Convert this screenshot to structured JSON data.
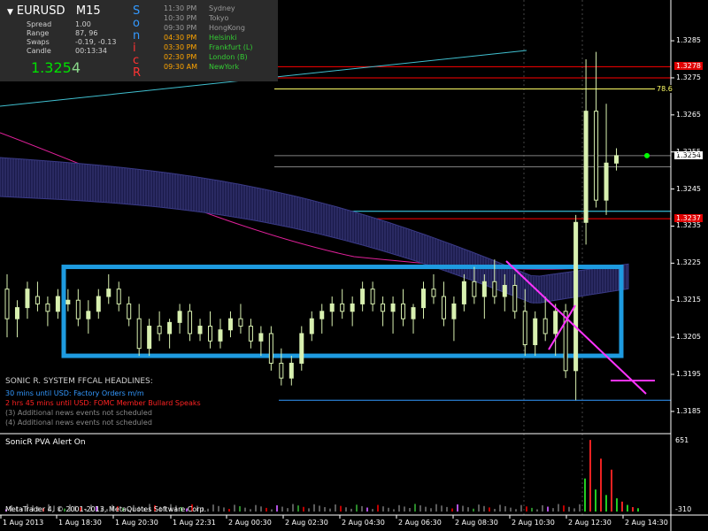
{
  "header": {
    "symbol": "EURUSD",
    "timeframe": "M15",
    "stats": [
      {
        "label": "Spread",
        "value": "1.00"
      },
      {
        "label": "Range",
        "value": "87, 96"
      },
      {
        "label": "Swaps",
        "value": "-0.19, -0.13"
      },
      {
        "label": "Candle",
        "value": "00:13:34"
      }
    ],
    "price_main": "1.325",
    "price_last": "4",
    "sonic_letters": [
      {
        "ch": "S",
        "color": "#3399ff"
      },
      {
        "ch": "o",
        "color": "#3399ff"
      },
      {
        "ch": "n",
        "color": "#3399ff"
      },
      {
        "ch": "i",
        "color": "#ff3333"
      },
      {
        "ch": "c",
        "color": "#ff3333"
      },
      {
        "ch": "R",
        "color": "#ff3333"
      }
    ],
    "sessions": [
      {
        "time": "11:30 PM",
        "name": "Sydney",
        "time_color": "#9a9a9a",
        "name_color": "#9a9a9a"
      },
      {
        "time": "10:30 PM",
        "name": "Tokyo",
        "time_color": "#9a9a9a",
        "name_color": "#9a9a9a"
      },
      {
        "time": "09:30 PM",
        "name": "HongKong",
        "time_color": "#9a9a9a",
        "name_color": "#9a9a9a"
      },
      {
        "time": "04:30 PM",
        "name": "Helsinki",
        "time_color": "#ffa500",
        "name_color": "#33cc33"
      },
      {
        "time": "03:30 PM",
        "name": "Frankfurt  (L)",
        "time_color": "#ffa500",
        "name_color": "#33cc33"
      },
      {
        "time": "02:30 PM",
        "name": "London  (B)",
        "time_color": "#ffa500",
        "name_color": "#33cc33"
      },
      {
        "time": "09:30 AM",
        "name": "NewYork",
        "time_color": "#ffa500",
        "name_color": "#33cc33"
      }
    ]
  },
  "news": {
    "title": "SONIC R. SYSTEM  FFCAL HEADLINES:",
    "items": [
      {
        "text": "30 mins until USD: Factory Orders m/m",
        "color": "#3399ff"
      },
      {
        "text": "2 hrs 45 mins until USD: FOMC Member Bullard Speaks",
        "color": "#ff2222"
      },
      {
        "text": "(3)  Additional news events not scheduled",
        "color": "#888888"
      },
      {
        "text": "(4)  Additional news events not scheduled",
        "color": "#888888"
      }
    ]
  },
  "indicator": {
    "title": "SonicR PVA   Alert On",
    "axis_top": "651",
    "axis_bottom": "-310"
  },
  "footer": {
    "copyright": "MetaTrader 4, © 2001-2013, MetaQuotes Software Corp."
  },
  "level_tags": [
    {
      "text": "1.3278",
      "bg": "#e00000",
      "fg": "#ffffff",
      "value": 1.3278
    },
    {
      "text": "78.6",
      "bg": "#000000",
      "fg": "#ffff66",
      "value": 1.3272
    },
    {
      "text": "1.3254",
      "bg": "#ffffff",
      "fg": "#000000",
      "value": 1.3254
    },
    {
      "text": "1.3237",
      "bg": "#e00000",
      "fg": "#ffffff",
      "value": 1.3237
    }
  ],
  "chart_data": {
    "type": "candlestick",
    "symbol": "EURUSD",
    "timeframe": "M15",
    "y_ticks": [
      1.3285,
      1.3275,
      1.3265,
      1.3255,
      1.3245,
      1.3235,
      1.3225,
      1.3215,
      1.3205,
      1.3195,
      1.3185
    ],
    "ylim": [
      1.3179,
      1.3296
    ],
    "x_labels": [
      "1 Aug 2013",
      "1 Aug 18:30",
      "1 Aug 20:30",
      "1 Aug 22:31",
      "2 Aug 00:30",
      "2 Aug 02:30",
      "2 Aug 04:30",
      "2 Aug 06:30",
      "2 Aug 08:30",
      "2 Aug 10:30",
      "2 Aug 12:30",
      "2 Aug 14:30"
    ],
    "horizontal_levels": [
      {
        "value": 1.3278,
        "color": "#ff0000"
      },
      {
        "value": 1.3275,
        "color": "#ff0000"
      },
      {
        "value": 1.3272,
        "color": "#ffff66"
      },
      {
        "value": 1.3254,
        "color": "#808080"
      },
      {
        "value": 1.3251,
        "color": "#808080"
      },
      {
        "value": 1.3239,
        "color": "#40e0ff"
      },
      {
        "value": 1.3237,
        "color": "#ff0000"
      },
      {
        "value": 1.3188,
        "color": "#3399ff"
      }
    ],
    "range_box": {
      "high": 1.3224,
      "low": 1.32,
      "color": "#1e9be0"
    },
    "candles_ohlc": [
      [
        1.3218,
        1.3222,
        1.3205,
        1.321
      ],
      [
        1.321,
        1.3215,
        1.3205,
        1.3213
      ],
      [
        1.3213,
        1.322,
        1.321,
        1.3218
      ],
      [
        1.3216,
        1.322,
        1.3212,
        1.3214
      ],
      [
        1.3214,
        1.3216,
        1.3208,
        1.3212
      ],
      [
        1.3212,
        1.3218,
        1.321,
        1.3216
      ],
      [
        1.3214,
        1.3218,
        1.3212,
        1.3215
      ],
      [
        1.3215,
        1.3218,
        1.3208,
        1.321
      ],
      [
        1.321,
        1.3215,
        1.3206,
        1.3212
      ],
      [
        1.3212,
        1.3218,
        1.321,
        1.3216
      ],
      [
        1.3216,
        1.3222,
        1.3214,
        1.3218
      ],
      [
        1.3218,
        1.322,
        1.3212,
        1.3214
      ],
      [
        1.3214,
        1.3216,
        1.3208,
        1.321
      ],
      [
        1.321,
        1.3214,
        1.32,
        1.3202
      ],
      [
        1.3202,
        1.321,
        1.32,
        1.3208
      ],
      [
        1.3208,
        1.3212,
        1.3204,
        1.3206
      ],
      [
        1.3206,
        1.321,
        1.3202,
        1.3209
      ],
      [
        1.3209,
        1.3214,
        1.3206,
        1.3212
      ],
      [
        1.3212,
        1.3214,
        1.3204,
        1.3206
      ],
      [
        1.3206,
        1.321,
        1.3204,
        1.3208
      ],
      [
        1.3208,
        1.3212,
        1.3202,
        1.3204
      ],
      [
        1.3204,
        1.321,
        1.3202,
        1.3207
      ],
      [
        1.3207,
        1.3212,
        1.3205,
        1.321
      ],
      [
        1.321,
        1.3214,
        1.3206,
        1.3208
      ],
      [
        1.3208,
        1.321,
        1.3202,
        1.3204
      ],
      [
        1.3204,
        1.3208,
        1.32,
        1.3206
      ],
      [
        1.3206,
        1.3208,
        1.3196,
        1.3198
      ],
      [
        1.3198,
        1.3202,
        1.3192,
        1.3194
      ],
      [
        1.3194,
        1.32,
        1.3192,
        1.3198
      ],
      [
        1.3198,
        1.3208,
        1.3196,
        1.3206
      ],
      [
        1.3206,
        1.3212,
        1.3204,
        1.321
      ],
      [
        1.321,
        1.3214,
        1.3206,
        1.3212
      ],
      [
        1.3212,
        1.3216,
        1.3208,
        1.3214
      ],
      [
        1.3214,
        1.3218,
        1.321,
        1.3212
      ],
      [
        1.3212,
        1.3216,
        1.3208,
        1.3214
      ],
      [
        1.3214,
        1.322,
        1.3212,
        1.3218
      ],
      [
        1.3218,
        1.322,
        1.3212,
        1.3214
      ],
      [
        1.3214,
        1.3216,
        1.3208,
        1.3212
      ],
      [
        1.3212,
        1.3216,
        1.3206,
        1.3214
      ],
      [
        1.3214,
        1.3218,
        1.3208,
        1.321
      ],
      [
        1.321,
        1.3214,
        1.3206,
        1.3213
      ],
      [
        1.3213,
        1.322,
        1.321,
        1.3218
      ],
      [
        1.3218,
        1.3222,
        1.3214,
        1.3216
      ],
      [
        1.3216,
        1.322,
        1.3208,
        1.321
      ],
      [
        1.321,
        1.3216,
        1.3204,
        1.3214
      ],
      [
        1.3214,
        1.3222,
        1.3212,
        1.322
      ],
      [
        1.322,
        1.3224,
        1.3214,
        1.3216
      ],
      [
        1.3216,
        1.3222,
        1.321,
        1.322
      ],
      [
        1.322,
        1.3226,
        1.3214,
        1.3216
      ],
      [
        1.3216,
        1.3222,
        1.3212,
        1.3219
      ],
      [
        1.3219,
        1.3222,
        1.321,
        1.3212
      ],
      [
        1.3212,
        1.3218,
        1.32,
        1.3203
      ],
      [
        1.3203,
        1.3212,
        1.32,
        1.321
      ],
      [
        1.321,
        1.3216,
        1.3204,
        1.3206
      ],
      [
        1.3206,
        1.3214,
        1.32,
        1.3212
      ],
      [
        1.3212,
        1.3214,
        1.3194,
        1.3196
      ],
      [
        1.3196,
        1.3238,
        1.3188,
        1.3236
      ],
      [
        1.3236,
        1.328,
        1.323,
        1.3266
      ],
      [
        1.3266,
        1.3282,
        1.324,
        1.3242
      ],
      [
        1.3242,
        1.3268,
        1.3238,
        1.3252
      ],
      [
        1.3252,
        1.3256,
        1.325,
        1.3254
      ]
    ],
    "indicator_histogram": {
      "ylim": [
        -310,
        651
      ]
    }
  }
}
